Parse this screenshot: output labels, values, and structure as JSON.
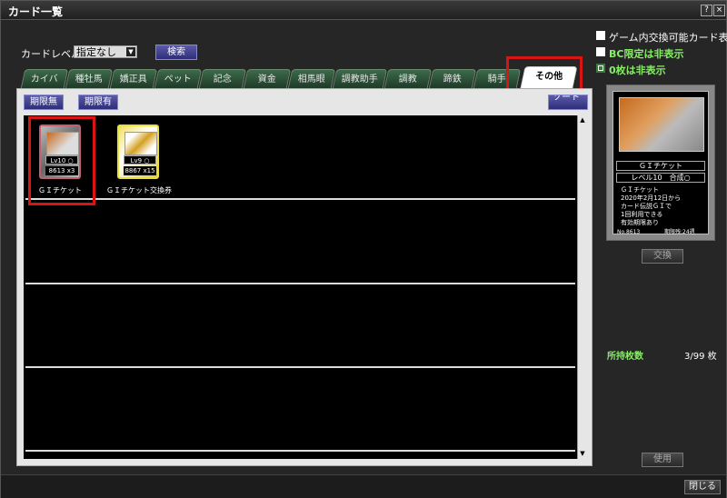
{
  "window": {
    "title": "カード一覧",
    "help_label": "?",
    "close_label": "×"
  },
  "filter": {
    "level_label": "カードレベル:",
    "level_value": "指定なし",
    "search_label": "検索"
  },
  "options": {
    "opt1": "ゲーム内交換可能カード表示",
    "opt2": "BC限定は非表示",
    "opt3": "0枚は非表示"
  },
  "tabs": [
    "カイバ",
    "種牡馬",
    "嬌正具",
    "ペット",
    "記念",
    "資金",
    "相馬眼",
    "調教助手",
    "調教",
    "蹄鉄",
    "騎手",
    "その他"
  ],
  "active_tab": "その他",
  "subtabs": {
    "no_limit": "期限無",
    "with_limit": "期限有",
    "sort": "ソート"
  },
  "cards": [
    {
      "level": "Lv10",
      "mark": "○",
      "number": "8613",
      "count": "x3",
      "name": "ＧＩチケット"
    },
    {
      "level": "Lv9",
      "mark": "○",
      "number": "8867",
      "count": "x15",
      "name": "ＧＩチケット交換券"
    }
  ],
  "preview": {
    "name": "ＧＩチケット",
    "level": "レベル10",
    "combine": "合成○",
    "desc": [
      "ＧＩチケット",
      "2020年2月12日から",
      "カード伝説ＧＩで",
      "1回利用できる",
      "有効期限あり"
    ],
    "no": "No.8613",
    "expiry": "期限残:24週"
  },
  "actions": {
    "exchange": "交換",
    "use": "使用",
    "close": "閉じる"
  },
  "owned": {
    "label": "所持枚数",
    "value": "3/99 枚"
  }
}
